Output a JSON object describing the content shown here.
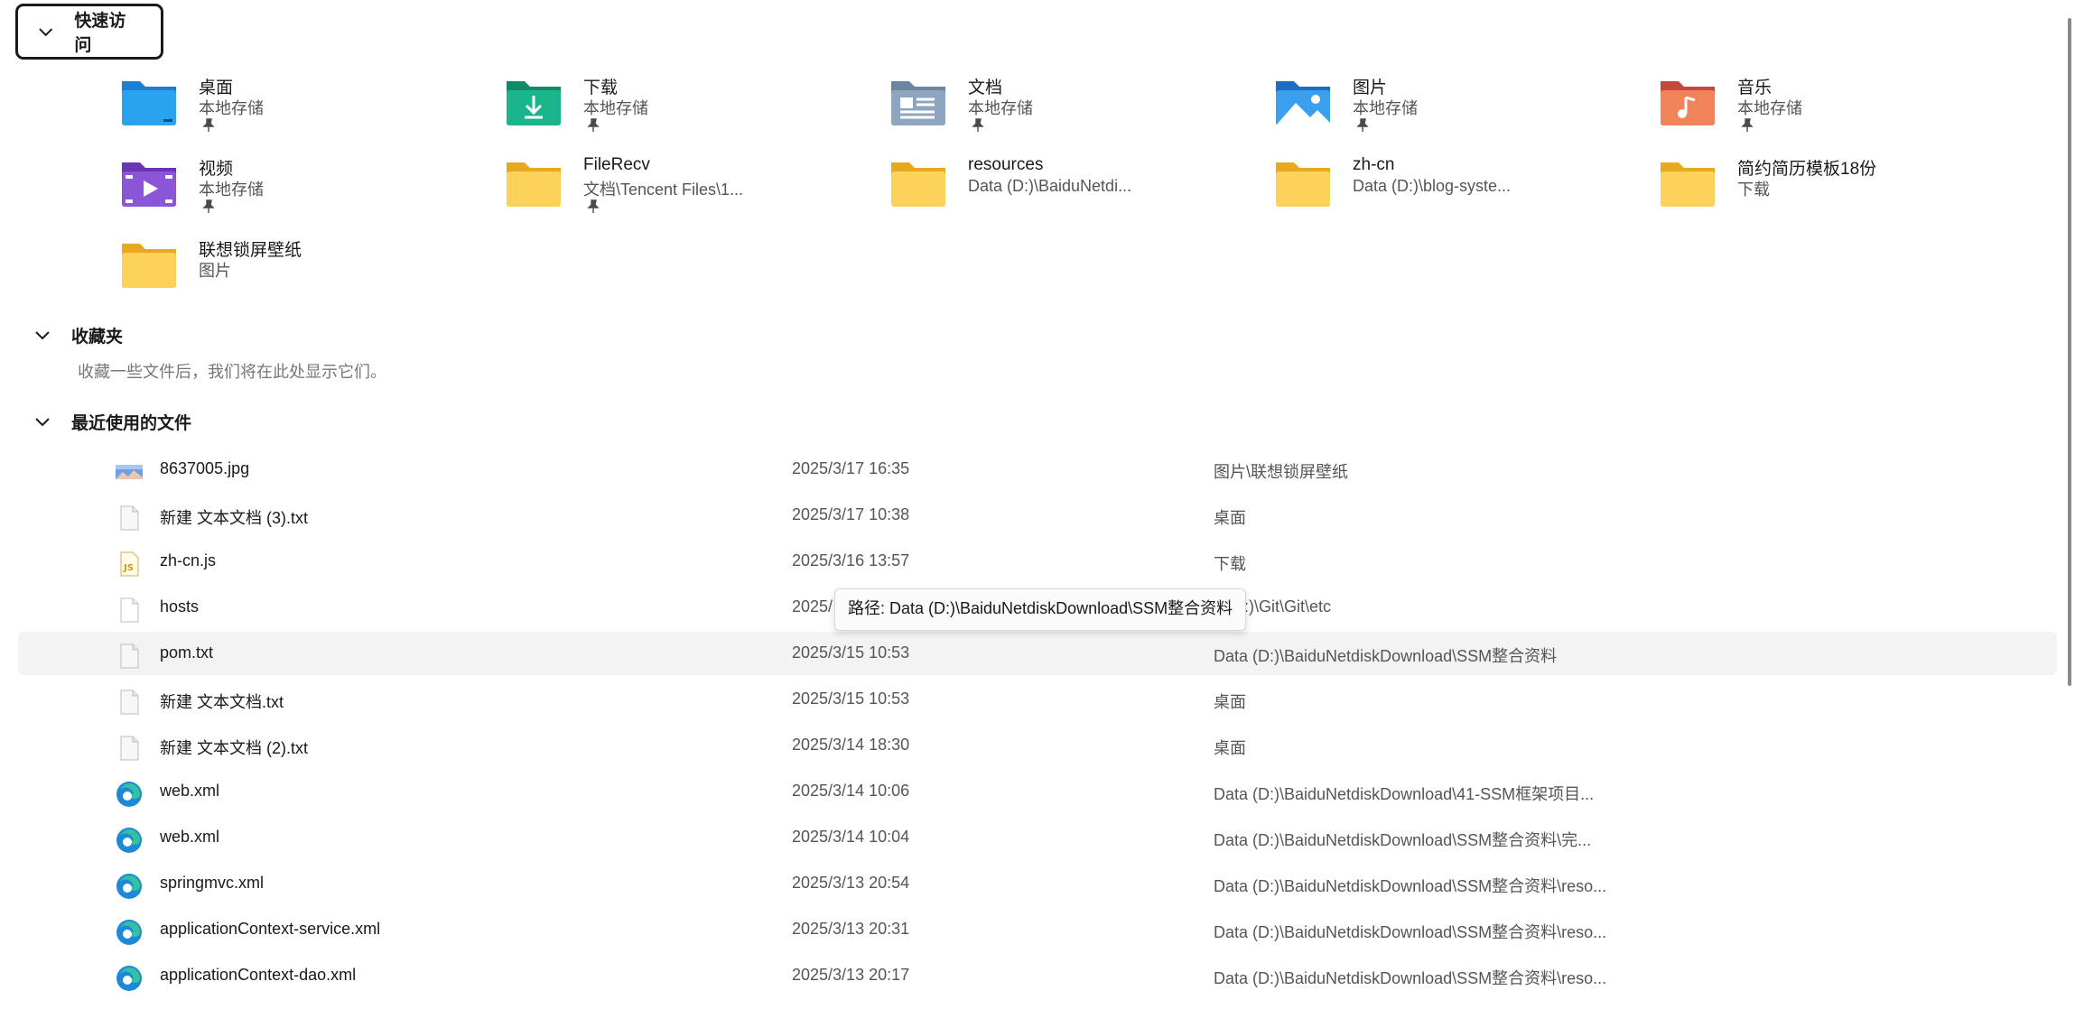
{
  "quick_access": {
    "label": "快速访问",
    "items": [
      {
        "name": "桌面",
        "sub": "本地存储",
        "icon": "desktop-folder-icon",
        "pinned": true
      },
      {
        "name": "下载",
        "sub": "本地存储",
        "icon": "downloads-folder-icon",
        "pinned": true
      },
      {
        "name": "文档",
        "sub": "本地存储",
        "icon": "documents-folder-icon",
        "pinned": true
      },
      {
        "name": "图片",
        "sub": "本地存储",
        "icon": "pictures-folder-icon",
        "pinned": true
      },
      {
        "name": "音乐",
        "sub": "本地存储",
        "icon": "music-folder-icon",
        "pinned": true
      },
      {
        "name": "视频",
        "sub": "本地存储",
        "icon": "videos-folder-icon",
        "pinned": true
      },
      {
        "name": "FileRecv",
        "sub": "文档\\Tencent Files\\1...",
        "icon": "folder-icon",
        "pinned": true
      },
      {
        "name": "resources",
        "sub": "Data (D:)\\BaiduNetdi...",
        "icon": "folder-icon",
        "pinned": false
      },
      {
        "name": "zh-cn",
        "sub": "Data (D:)\\blog-syste...",
        "icon": "folder-icon",
        "pinned": false
      },
      {
        "name": "简约简历模板18份",
        "sub": "下载",
        "icon": "folder-icon",
        "pinned": false
      },
      {
        "name": "联想锁屏壁纸",
        "sub": "图片",
        "icon": "folder-icon",
        "pinned": false
      }
    ]
  },
  "favorites": {
    "label": "收藏夹",
    "empty_text": "收藏一些文件后，我们将在此处显示它们。"
  },
  "recent": {
    "label": "最近使用的文件",
    "files": [
      {
        "name": "8637005.jpg",
        "date": "2025/3/17 16:35",
        "location": "图片\\联想锁屏壁纸",
        "icon": "image-file-icon"
      },
      {
        "name": "新建 文本文档 (3).txt",
        "date": "2025/3/17 10:38",
        "location": "桌面",
        "icon": "text-file-icon"
      },
      {
        "name": "zh-cn.js",
        "date": "2025/3/16 13:57",
        "location": "下载",
        "icon": "js-file-icon"
      },
      {
        "name": "hosts",
        "date": "2025/",
        "location": "a (D:)\\Git\\Git\\etc",
        "icon": "blank-file-icon"
      },
      {
        "name": "pom.txt",
        "date": "2025/3/15 10:53",
        "location": "Data (D:)\\BaiduNetdiskDownload\\SSM整合资料",
        "icon": "text-file-icon"
      },
      {
        "name": "新建 文本文档.txt",
        "date": "2025/3/15 10:53",
        "location": "桌面",
        "icon": "text-file-icon"
      },
      {
        "name": "新建 文本文档 (2).txt",
        "date": "2025/3/14 18:30",
        "location": "桌面",
        "icon": "text-file-icon"
      },
      {
        "name": "web.xml",
        "date": "2025/3/14 10:06",
        "location": "Data (D:)\\BaiduNetdiskDownload\\41-SSM框架项目...",
        "icon": "edge-xml-file-icon"
      },
      {
        "name": "web.xml",
        "date": "2025/3/14 10:04",
        "location": "Data (D:)\\BaiduNetdiskDownload\\SSM整合资料\\完...",
        "icon": "edge-xml-file-icon"
      },
      {
        "name": "springmvc.xml",
        "date": "2025/3/13 20:54",
        "location": "Data (D:)\\BaiduNetdiskDownload\\SSM整合资料\\reso...",
        "icon": "edge-xml-file-icon"
      },
      {
        "name": "applicationContext-service.xml",
        "date": "2025/3/13 20:31",
        "location": "Data (D:)\\BaiduNetdiskDownload\\SSM整合资料\\reso...",
        "icon": "edge-xml-file-icon"
      },
      {
        "name": "applicationContext-dao.xml",
        "date": "2025/3/13 20:17",
        "location": "Data (D:)\\BaiduNetdiskDownload\\SSM整合资料\\reso...",
        "icon": "edge-xml-file-icon"
      }
    ]
  },
  "tooltip": {
    "text": "路径: Data (D:)\\BaiduNetdiskDownload\\SSM整合资料"
  }
}
